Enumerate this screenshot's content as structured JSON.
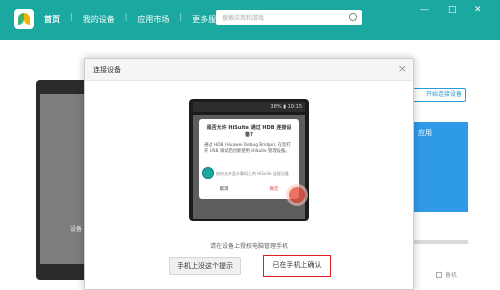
{
  "app": {
    "nav": [
      "首页",
      "我的设备",
      "应用市场",
      "更多服务"
    ],
    "search_placeholder": "搜索应用和游戏",
    "window_controls": [
      "—",
      "□",
      "✕"
    ]
  },
  "background": {
    "device_label": "设备",
    "right_button": "开始连接设备",
    "tile_label": "应用",
    "bottom_link": "备机"
  },
  "dialog": {
    "title": "连接设备",
    "close": "×",
    "phone": {
      "status": "38% ▮ 10:15",
      "popup_title": "是否允许 HiSuite 通过 HDB 连接设备?",
      "popup_desc": "通过 HDB (Huawei Debug Bridge), 在您打开 USB 调试后也能使用 HiSuite 管理设备。",
      "popup_check": "始终允许此计算机上的 HiSuite 连接设备",
      "cancel": "取消",
      "confirm": "确定"
    },
    "instruction": "请在设备上授权电脑管理手机",
    "buttons": {
      "no_prompt": "手机上没这个提示",
      "confirmed": "已在手机上确认"
    }
  }
}
